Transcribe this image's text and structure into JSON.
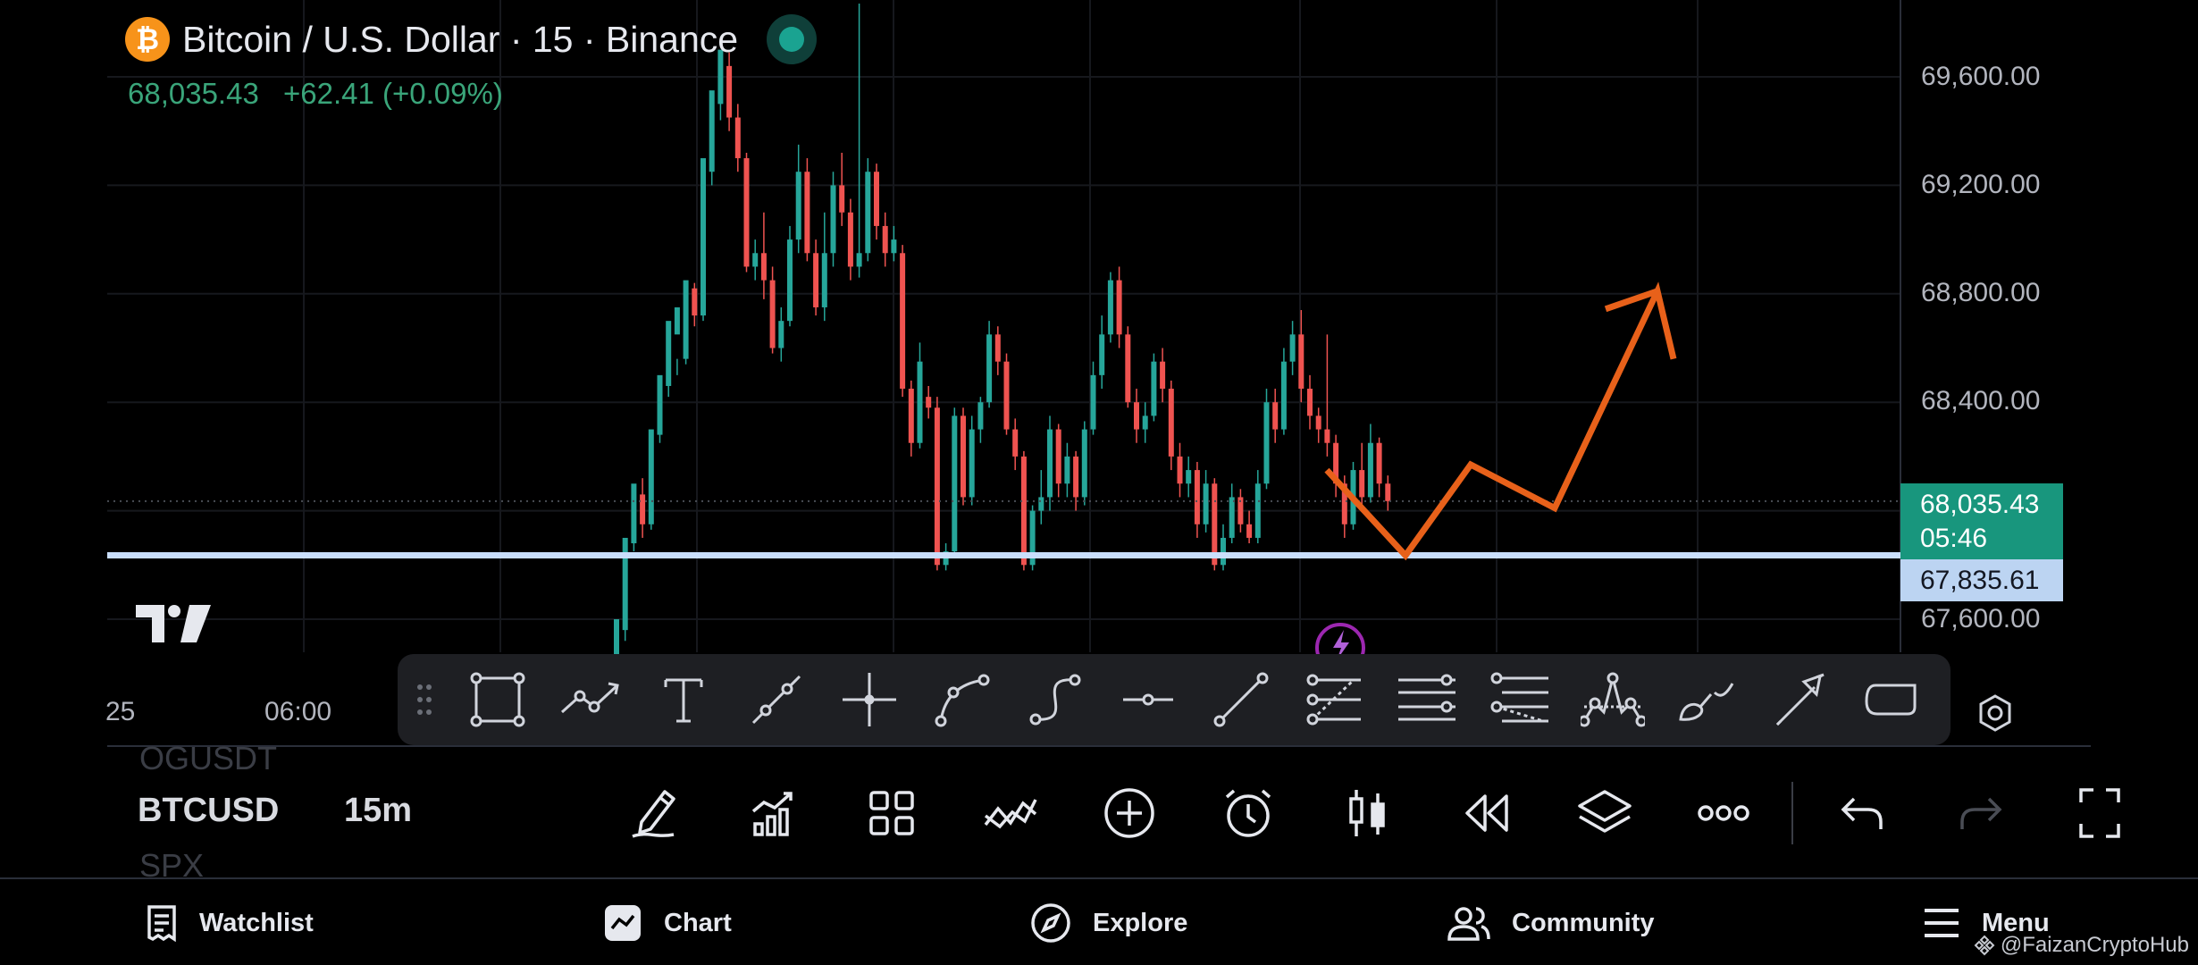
{
  "header": {
    "logo_glyph": "₿",
    "symbol_title": "Bitcoin / U.S. Dollar · 15 · Binance",
    "last_price": "68,035.43",
    "change": "+62.41 (+0.09%)"
  },
  "price_axis": {
    "labels": [
      "69,600.00",
      "69,200.00",
      "68,800.00",
      "68,400.00",
      "67,600.00"
    ],
    "last_price_label": "68,035.43",
    "countdown": "05:46",
    "hline_label": "67,835.61"
  },
  "time_axis": {
    "labels": [
      "25",
      "06:00"
    ]
  },
  "colors": {
    "up": "#26a69a",
    "down": "#ef5350",
    "drawing": "#e8611a",
    "hline": "#c9defb",
    "live": "#1aa391"
  },
  "drawing_toolbar": {
    "tools": [
      "rectangle-icon",
      "path-icon",
      "text-icon",
      "trend-line-icon",
      "crosshair-icon",
      "arc-icon",
      "curve-icon",
      "horizontal-ray-icon",
      "line-icon",
      "fib-retracement-icon",
      "parallel-lines-icon",
      "fib-extension-icon",
      "pattern-icon",
      "brush-icon",
      "arrow-icon",
      "shape-icon"
    ]
  },
  "lower_bar": {
    "symbol_prev": "OGUSDT",
    "symbol_current": "BTCUSD",
    "symbol_next": "SPX",
    "interval": "15m",
    "tools": [
      "pencil-icon",
      "indicators-icon",
      "layout-grid-icon",
      "compare-icon",
      "add-icon",
      "alert-clock-icon",
      "candle-type-icon",
      "replay-icon",
      "layers-icon",
      "more-icon",
      "undo-icon",
      "redo-icon",
      "fullscreen-icon"
    ]
  },
  "bottom_nav": {
    "items": [
      {
        "label": "Watchlist",
        "icon": "watchlist-icon"
      },
      {
        "label": "Chart",
        "icon": "chart-icon"
      },
      {
        "label": "Explore",
        "icon": "compass-icon"
      },
      {
        "label": "Community",
        "icon": "community-icon"
      },
      {
        "label": "Menu",
        "icon": "menu-icon"
      }
    ],
    "watermark": "@FaizanCryptoHub"
  },
  "chart_data": {
    "type": "candlestick",
    "title": "Bitcoin / U.S. Dollar · 15 · Binance",
    "ylim": [
      67482,
      69870
    ],
    "y_ticks": [
      69600,
      69200,
      68800,
      68400,
      67600
    ],
    "last_price": 68035.43,
    "horizontal_line": 67835.61,
    "candles": [
      [
        67450,
        67600,
        67380,
        67560
      ],
      [
        67560,
        67900,
        67520,
        67880
      ],
      [
        67880,
        68100,
        67850,
        68060
      ],
      [
        68060,
        67950,
        67900,
        68120
      ],
      [
        67950,
        68300,
        67930,
        68280
      ],
      [
        68280,
        68500,
        68250,
        68460
      ],
      [
        68460,
        68700,
        68420,
        68650
      ],
      [
        68650,
        68750,
        68500,
        68560
      ],
      [
        68560,
        68850,
        68540,
        68820
      ],
      [
        68820,
        68720,
        68680,
        68840
      ],
      [
        68720,
        69300,
        68700,
        69250
      ],
      [
        69250,
        69550,
        69200,
        69500
      ],
      [
        69500,
        69700,
        69440,
        69640
      ],
      [
        69640,
        69450,
        69400,
        69690
      ],
      [
        69450,
        69300,
        69250,
        69500
      ],
      [
        69300,
        68900,
        68880,
        69320
      ],
      [
        68900,
        68950,
        68850,
        69000
      ],
      [
        68950,
        68850,
        68780,
        69100
      ],
      [
        68850,
        68600,
        68580,
        68900
      ],
      [
        68600,
        68700,
        68550,
        68750
      ],
      [
        68700,
        69000,
        68680,
        69050
      ],
      [
        69000,
        69250,
        68950,
        69350
      ],
      [
        69250,
        68950,
        68920,
        69300
      ],
      [
        68950,
        68750,
        68720,
        69000
      ],
      [
        68750,
        68950,
        68700,
        69100
      ],
      [
        68950,
        69200,
        68900,
        69250
      ],
      [
        69200,
        69100,
        69050,
        69320
      ],
      [
        69100,
        68900,
        68850,
        69150
      ],
      [
        68900,
        68950,
        68860,
        69870
      ],
      [
        68950,
        69250,
        68920,
        69300
      ],
      [
        69250,
        69050,
        69000,
        69280
      ],
      [
        69050,
        68950,
        68900,
        69100
      ],
      [
        68950,
        69000,
        68920,
        69050
      ],
      [
        68950,
        68450,
        68420,
        68980
      ],
      [
        68450,
        68250,
        68200,
        68480
      ],
      [
        68250,
        68550,
        68230,
        68620
      ],
      [
        68420,
        68380,
        68340,
        68460
      ],
      [
        68380,
        67800,
        67780,
        68420
      ],
      [
        67800,
        67850,
        67780,
        67880
      ],
      [
        67850,
        68350,
        67840,
        68380
      ],
      [
        68350,
        68050,
        68020,
        68380
      ],
      [
        68050,
        68300,
        68020,
        68350
      ],
      [
        68300,
        68400,
        68250,
        68420
      ],
      [
        68400,
        68650,
        68380,
        68700
      ],
      [
        68650,
        68550,
        68500,
        68680
      ],
      [
        68550,
        68300,
        68280,
        68580
      ],
      [
        68300,
        68200,
        68150,
        68340
      ],
      [
        68200,
        67800,
        67780,
        68220
      ],
      [
        67800,
        68000,
        67780,
        68020
      ],
      [
        68000,
        68050,
        67950,
        68150
      ],
      [
        68050,
        68300,
        68000,
        68350
      ],
      [
        68300,
        68100,
        68050,
        68320
      ],
      [
        68100,
        68200,
        68050,
        68250
      ],
      [
        68200,
        68050,
        68000,
        68220
      ],
      [
        68050,
        68300,
        68020,
        68330
      ],
      [
        68300,
        68500,
        68280,
        68550
      ],
      [
        68500,
        68650,
        68450,
        68720
      ],
      [
        68650,
        68850,
        68620,
        68880
      ],
      [
        68850,
        68650,
        68600,
        68900
      ],
      [
        68650,
        68400,
        68380,
        68680
      ],
      [
        68400,
        68300,
        68250,
        68450
      ],
      [
        68300,
        68350,
        68250,
        68400
      ],
      [
        68350,
        68550,
        68330,
        68580
      ],
      [
        68550,
        68450,
        68400,
        68600
      ],
      [
        68450,
        68200,
        68150,
        68480
      ],
      [
        68200,
        68100,
        68050,
        68250
      ],
      [
        68100,
        68150,
        68050,
        68200
      ],
      [
        68150,
        67950,
        67900,
        68180
      ],
      [
        67950,
        68100,
        67920,
        68150
      ],
      [
        68100,
        67800,
        67780,
        68120
      ],
      [
        67800,
        67900,
        67780,
        67950
      ],
      [
        67900,
        68050,
        67880,
        68100
      ],
      [
        68050,
        67950,
        67920,
        68080
      ],
      [
        67950,
        67900,
        67880,
        68000
      ],
      [
        67900,
        68100,
        67880,
        68150
      ],
      [
        68100,
        68400,
        68080,
        68450
      ],
      [
        68400,
        68300,
        68250,
        68450
      ],
      [
        68300,
        68550,
        68280,
        68600
      ],
      [
        68550,
        68650,
        68500,
        68700
      ],
      [
        68650,
        68450,
        68400,
        68740
      ],
      [
        68450,
        68350,
        68300,
        68500
      ],
      [
        68350,
        68300,
        68250,
        68380
      ],
      [
        68300,
        68250,
        68200,
        68650
      ],
      [
        68250,
        68100,
        68050,
        68280
      ],
      [
        68100,
        67950,
        67900,
        68130
      ],
      [
        67950,
        68150,
        67930,
        68180
      ],
      [
        68150,
        68050,
        68000,
        68250
      ],
      [
        68050,
        68250,
        68030,
        68320
      ],
      [
        68250,
        68100,
        68050,
        68270
      ],
      [
        68100,
        68035.43,
        68000,
        68130
      ]
    ],
    "projection": [
      [
        68150,
        0
      ],
      [
        67835,
        1
      ],
      [
        68170,
        2
      ],
      [
        68010,
        3
      ],
      [
        68810,
        4
      ],
      [
        68560,
        4.3
      ]
    ]
  }
}
